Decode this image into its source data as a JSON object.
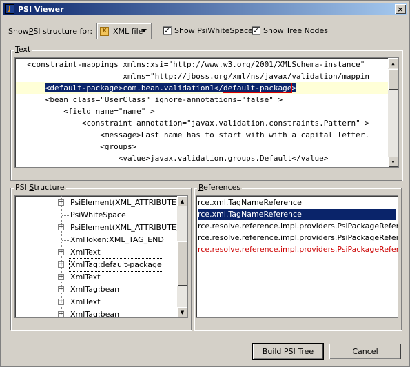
{
  "window": {
    "title": "PSI Viewer",
    "close_glyph": "×"
  },
  "toolbar": {
    "show_label_pre": "Show ",
    "show_label_u": "P",
    "show_label_post": "SI structure for:",
    "filetype": "XML file",
    "whitespace_pre": "Show Psi",
    "whitespace_u": "W",
    "whitespace_post": "hiteSpace",
    "whitespace_checked": true,
    "treenodes_label": "Show Tree Nodes",
    "treenodes_checked": true
  },
  "text_section": {
    "title_u": "T",
    "title_rest": "ext",
    "lines": [
      {
        "text": "  <constraint-mappings xmlns:xsi=\"http://www.w3.org/2001/XMLSchema-instance\""
      },
      {
        "text": "                       xmlns=\"http://jboss.org/xml/ns/javax/validation/mappin"
      },
      {
        "pre": "      ",
        "sel": "<default-package>com.bean.validation1</",
        "boxed": "default-package",
        "sel_end": ">"
      },
      {
        "text": "      <bean class=\"UserClass\" ignore-annotations=\"false\" >"
      },
      {
        "text": "          <field name=\"name\" >"
      },
      {
        "text": "              <constraint annotation=\"javax.validation.constraints.Pattern\" >"
      },
      {
        "text": "                  <message>Last name has to start with with a capital letter."
      },
      {
        "text": "                  <groups>"
      },
      {
        "text": "                      <value>javax.validation.groups.Default</value>"
      },
      {
        "text": "                      ."
      }
    ]
  },
  "psi_structure": {
    "title_pre": "PSI ",
    "title_u": "S",
    "title_post": "tructure",
    "items": [
      {
        "label": "PsiElement(XML_ATTRIBUTE)",
        "expandable": true
      },
      {
        "label": "PsiWhiteSpace",
        "expandable": false
      },
      {
        "label": "PsiElement(XML_ATTRIBUTE)",
        "expandable": true
      },
      {
        "label": "XmlToken:XML_TAG_END",
        "expandable": false
      },
      {
        "label": "XmlText",
        "expandable": true
      },
      {
        "label": "XmlTag:default-package",
        "expandable": true,
        "focused": true
      },
      {
        "label": "XmlText",
        "expandable": true
      },
      {
        "label": "XmlTag:bean",
        "expandable": true
      },
      {
        "label": "XmlText",
        "expandable": true
      },
      {
        "label": "XmlTag:bean",
        "expandable": true
      }
    ]
  },
  "references": {
    "title_u": "R",
    "title_rest": "eferences",
    "items": [
      {
        "label": "rce.xml.TagNameReference",
        "state": "normal"
      },
      {
        "label": "rce.xml.TagNameReference",
        "state": "selected"
      },
      {
        "label": "rce.resolve.reference.impl.providers.PsiPackageReference",
        "state": "normal"
      },
      {
        "label": "rce.resolve.reference.impl.providers.PsiPackageReference",
        "state": "normal"
      },
      {
        "label": "rce.resolve.reference.impl.providers.PsiPackageReference",
        "state": "error"
      }
    ]
  },
  "buttons": {
    "build_u": "B",
    "build_rest": "uild PSI Tree",
    "cancel": "Cancel"
  },
  "colors": {
    "selection": "#0a246a",
    "caret_line": "#ffffd7",
    "error_text": "#cc0000",
    "title_gradient_start": "#0a246a"
  }
}
